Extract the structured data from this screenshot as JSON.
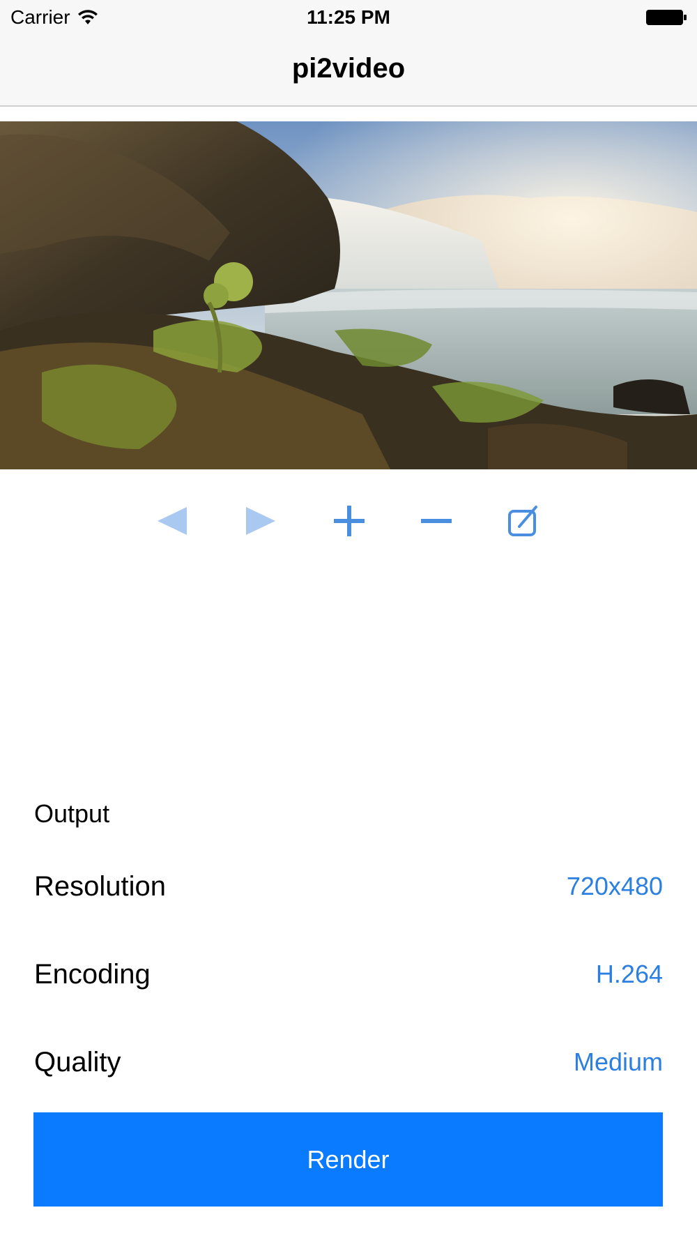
{
  "status_bar": {
    "carrier": "Carrier",
    "time": "11:25 PM"
  },
  "nav": {
    "title": "pi2video"
  },
  "toolbar": {
    "icons": [
      "previous-icon",
      "next-icon",
      "add-icon",
      "remove-icon",
      "edit-icon"
    ]
  },
  "output": {
    "section_title": "Output",
    "rows": [
      {
        "label": "Resolution",
        "value": "720x480"
      },
      {
        "label": "Encoding",
        "value": "H.264"
      },
      {
        "label": "Quality",
        "value": "Medium"
      }
    ]
  },
  "render_button": {
    "label": "Render"
  },
  "colors": {
    "accent": "#0a7aff",
    "value_text": "#2b7fe0",
    "toolbar_icon": "#4a8ee0",
    "toolbar_icon_disabled": "#a9c9f0"
  }
}
